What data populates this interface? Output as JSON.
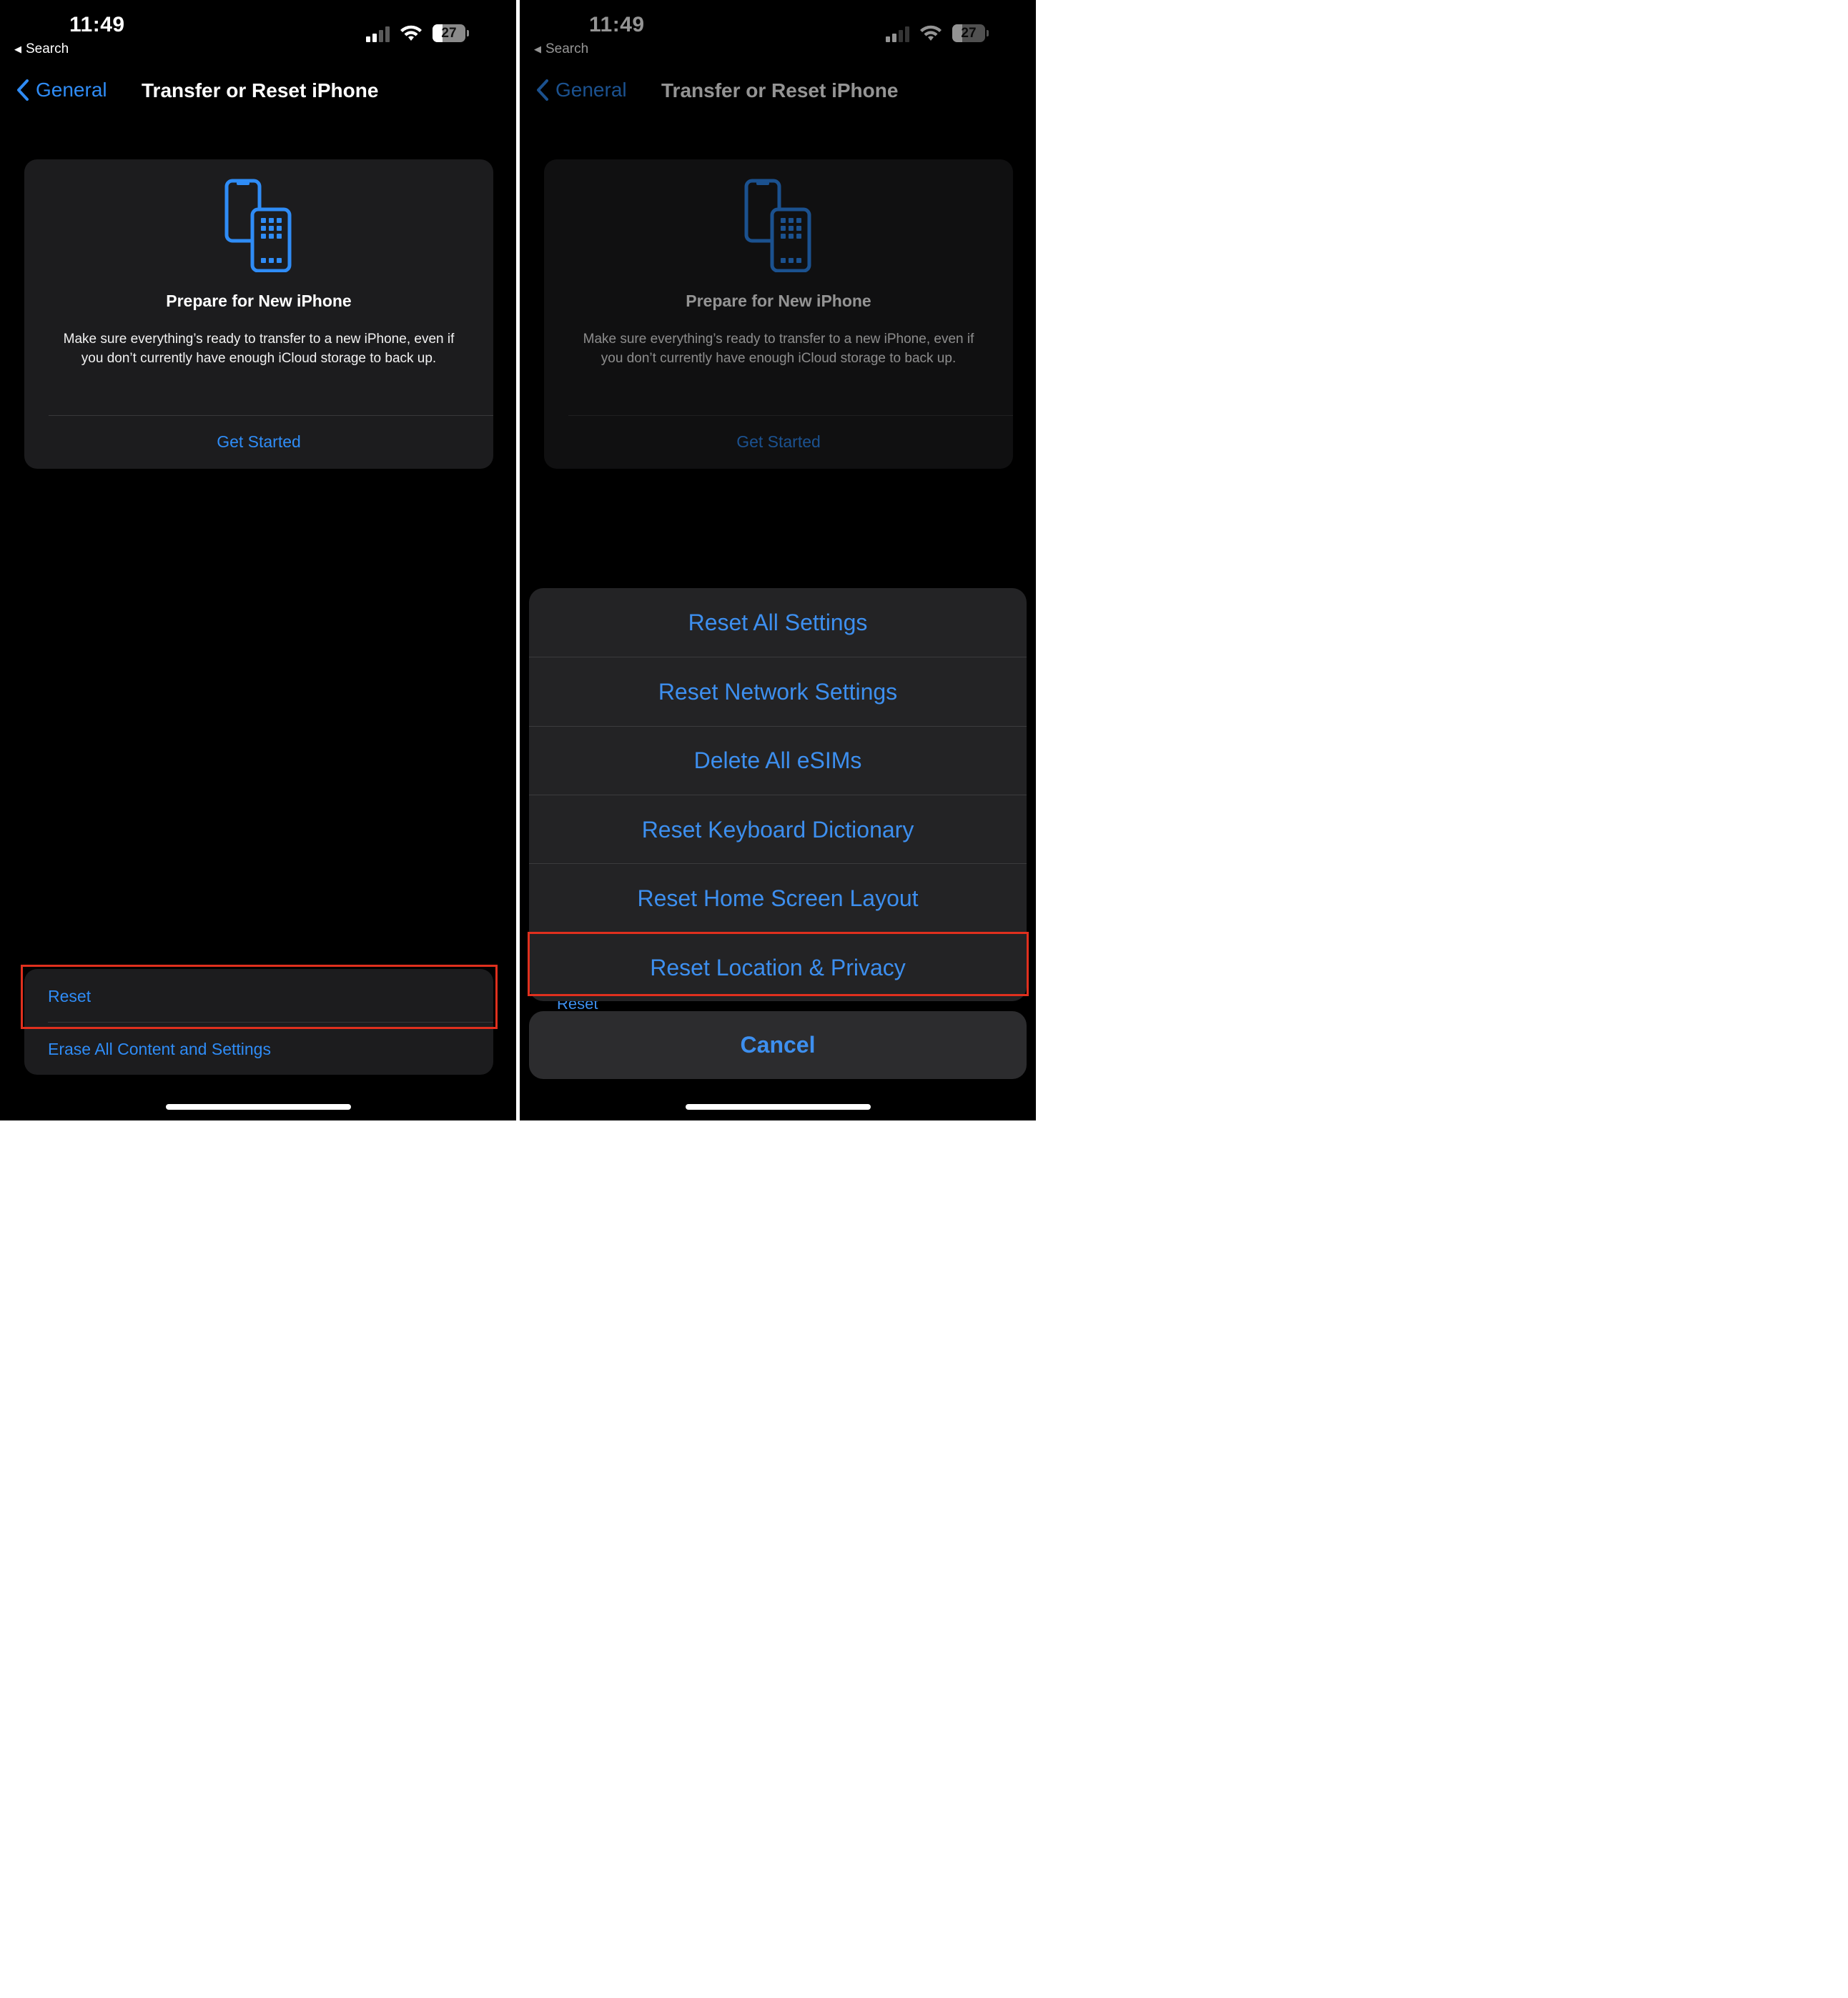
{
  "status_bar": {
    "time": "11:49",
    "back_app": "Search",
    "battery": "27"
  },
  "nav": {
    "back_label": "General",
    "title": "Transfer or Reset iPhone"
  },
  "prepare_card": {
    "title": "Prepare for New iPhone",
    "description": "Make sure everything’s ready to transfer to a new iPhone, even if you don’t currently have enough iCloud storage to back up.",
    "link": "Get Started"
  },
  "bottom_group": {
    "items": [
      {
        "label": "Reset"
      },
      {
        "label": "Erase All Content and Settings"
      }
    ]
  },
  "action_sheet": {
    "items": [
      {
        "label": "Reset All Settings"
      },
      {
        "label": "Reset Network Settings"
      },
      {
        "label": "Delete All eSIMs"
      },
      {
        "label": "Reset Keyboard Dictionary"
      },
      {
        "label": "Reset Home Screen Layout"
      },
      {
        "label": "Reset Location & Privacy"
      }
    ],
    "cancel_label": "Cancel",
    "peek_label": "Reset"
  },
  "colors": {
    "accent": "#2f8cf6",
    "highlight": "#e0301e",
    "background": "#000000",
    "card": "#1c1c1e"
  }
}
